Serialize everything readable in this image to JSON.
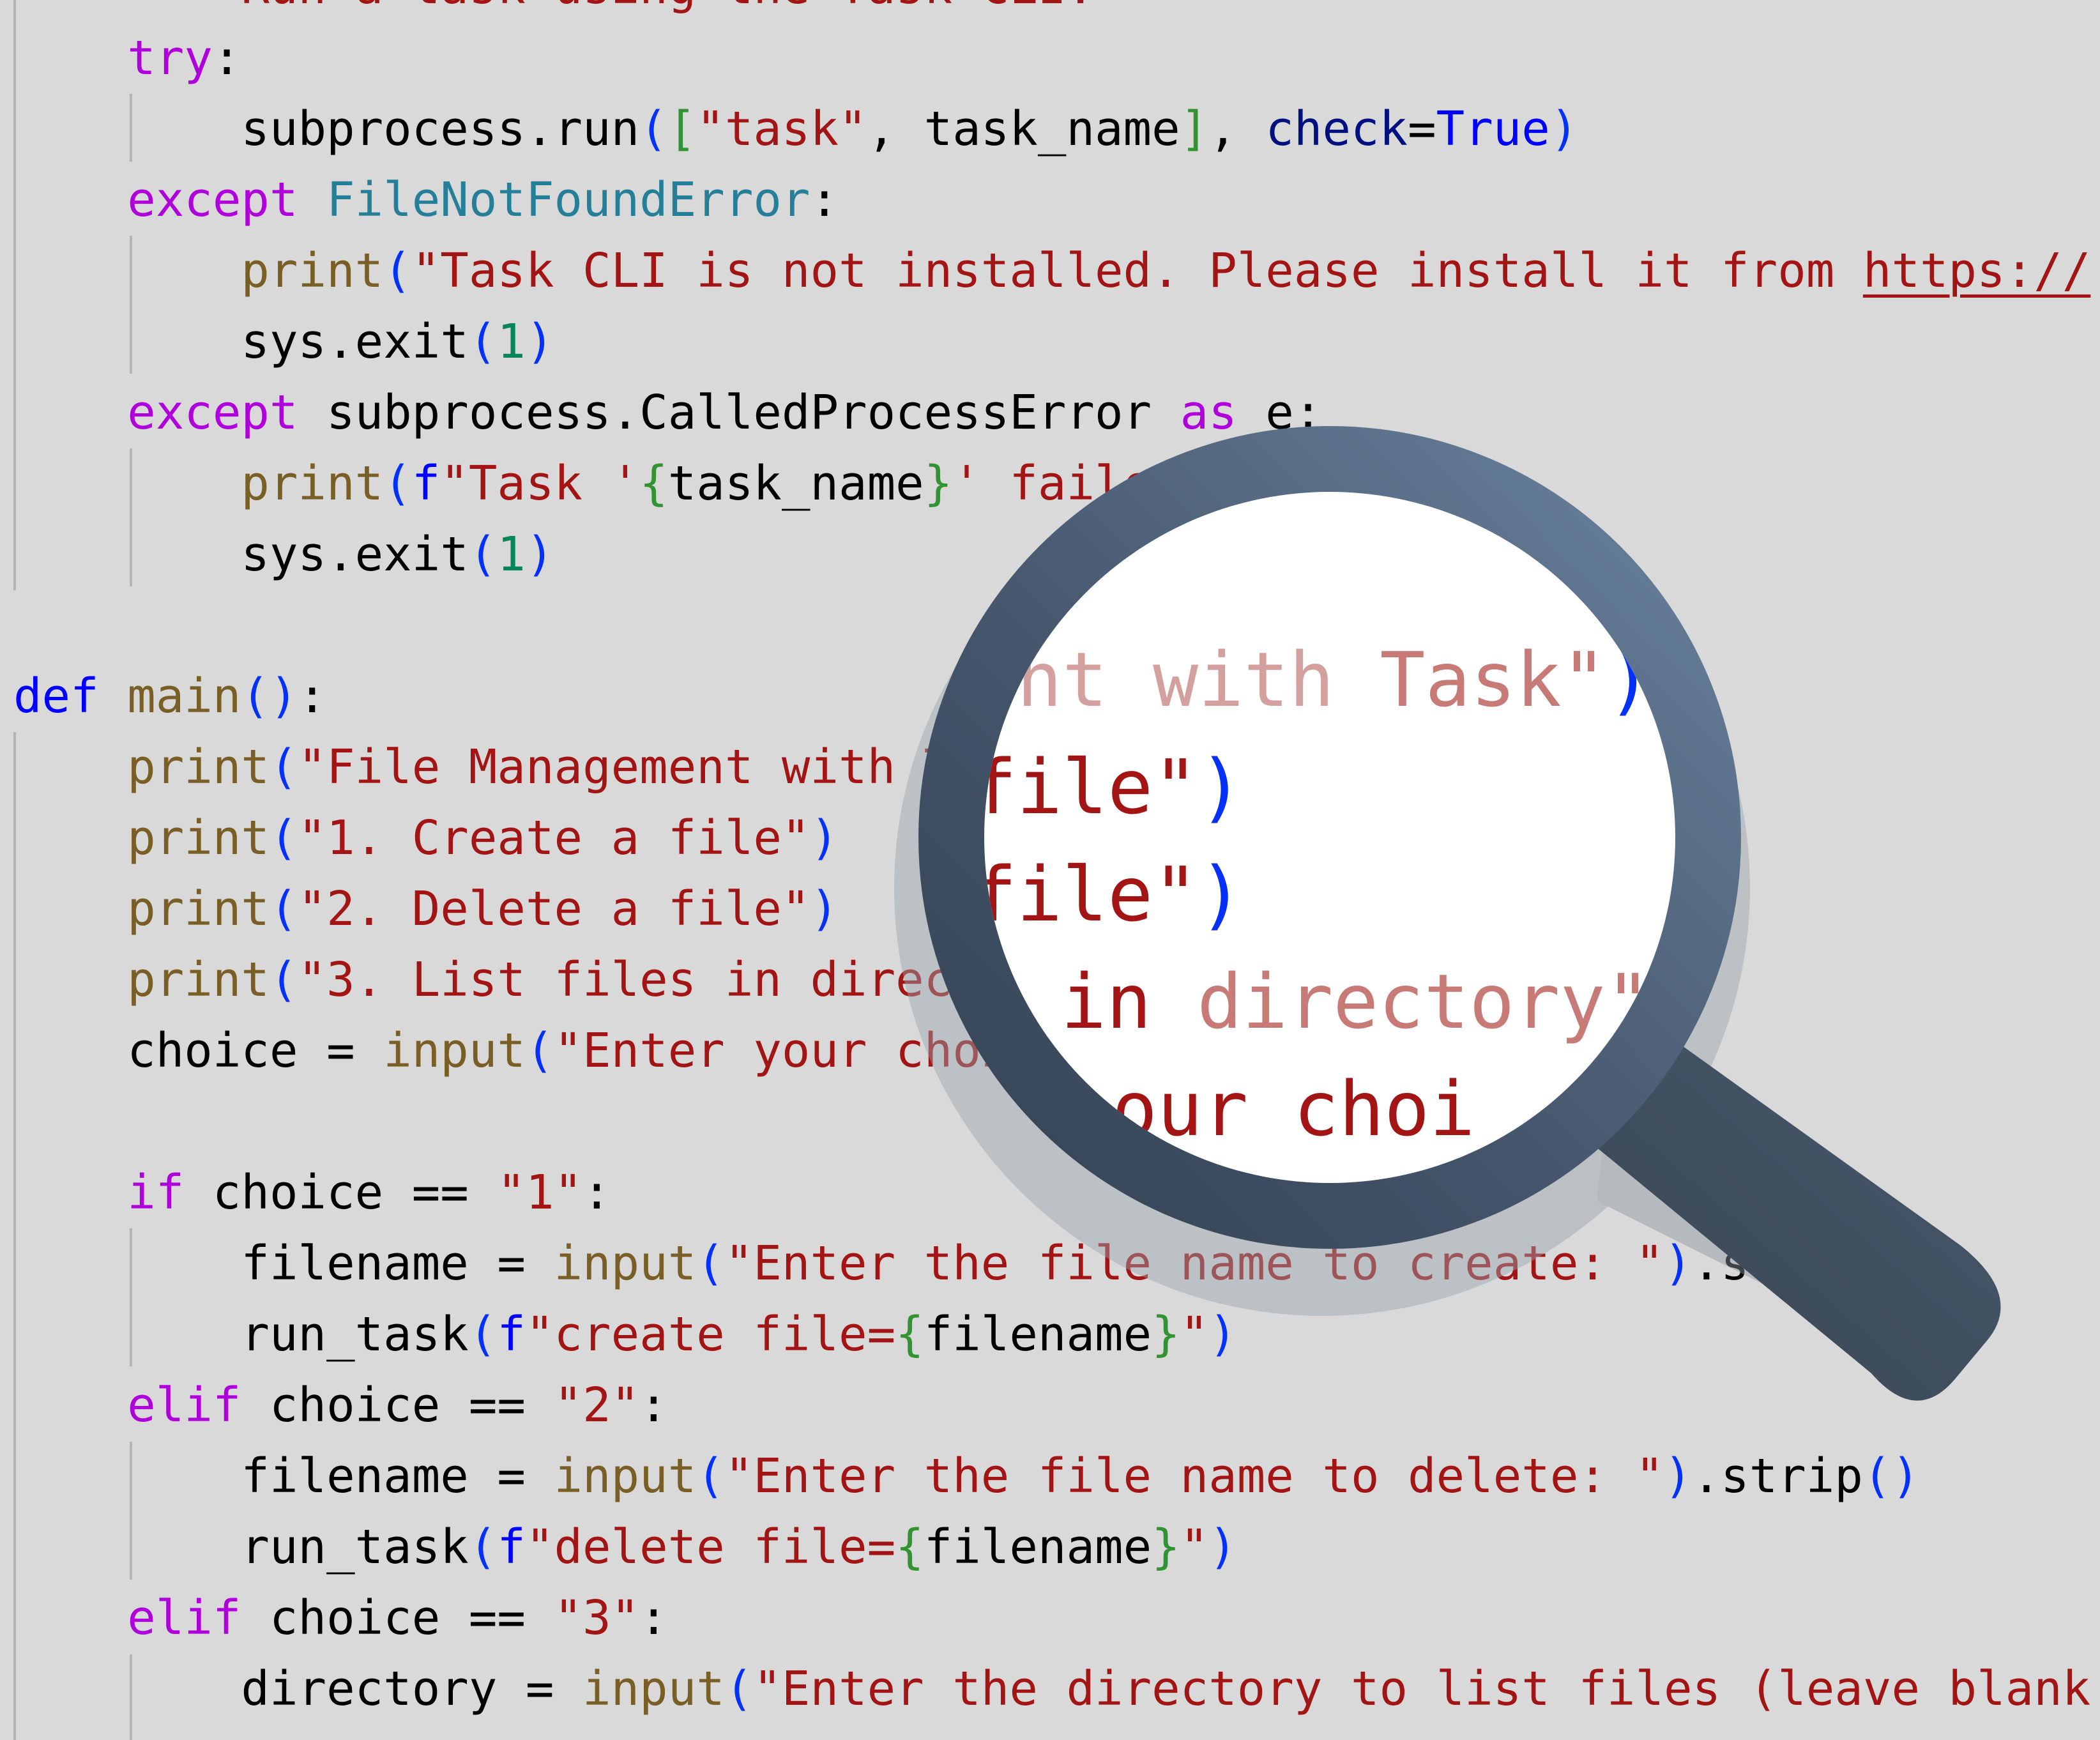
{
  "editor": {
    "language": "python",
    "colors": {
      "background": "#d9d9d9",
      "keyword_control": "#af00db",
      "keyword_def": "#0000ff",
      "function": "#795e26",
      "string": "#a31515",
      "number": "#098658",
      "paren": "#0431fa",
      "fstring_brace": "#319331",
      "class": "#267f99",
      "parameter": "#001080",
      "indent_guide": "#b4b4b4"
    },
    "lines": [
      {
        "tokens": [
          {
            "t": "        Run a task using the Task CLI.",
            "c": "str"
          }
        ]
      },
      {
        "tokens": [
          {
            "t": "    "
          },
          {
            "t": "try",
            "c": "kw"
          },
          {
            "t": ":"
          }
        ]
      },
      {
        "tokens": [
          {
            "t": "        subprocess.run"
          },
          {
            "t": "(",
            "c": "par"
          },
          {
            "t": "[",
            "c": "brk"
          },
          {
            "t": "\"task\"",
            "c": "str"
          },
          {
            "t": ", task_name"
          },
          {
            "t": "]",
            "c": "brk"
          },
          {
            "t": ", "
          },
          {
            "t": "check",
            "c": "param"
          },
          {
            "t": "="
          },
          {
            "t": "True",
            "c": "const"
          },
          {
            "t": ")",
            "c": "par"
          }
        ]
      },
      {
        "tokens": [
          {
            "t": "    "
          },
          {
            "t": "except",
            "c": "kw"
          },
          {
            "t": " "
          },
          {
            "t": "FileNotFoundError",
            "c": "cls"
          },
          {
            "t": ":"
          }
        ]
      },
      {
        "tokens": [
          {
            "t": "        "
          },
          {
            "t": "print",
            "c": "fn"
          },
          {
            "t": "(",
            "c": "par"
          },
          {
            "t": "\"Task CLI is not installed. Please install it from ",
            "c": "str"
          },
          {
            "t": "https://",
            "c": "str url"
          }
        ]
      },
      {
        "tokens": [
          {
            "t": "        sys.exit"
          },
          {
            "t": "(",
            "c": "par"
          },
          {
            "t": "1",
            "c": "num"
          },
          {
            "t": ")",
            "c": "par"
          }
        ]
      },
      {
        "tokens": [
          {
            "t": "    "
          },
          {
            "t": "except",
            "c": "kw"
          },
          {
            "t": " subprocess.CalledProcessError "
          },
          {
            "t": "as",
            "c": "kw"
          },
          {
            "t": " e:"
          }
        ]
      },
      {
        "tokens": [
          {
            "t": "        "
          },
          {
            "t": "print",
            "c": "fn"
          },
          {
            "t": "(",
            "c": "par"
          },
          {
            "t": "f",
            "c": "def"
          },
          {
            "t": "\"Task '",
            "c": "str"
          },
          {
            "t": "{",
            "c": "brk"
          },
          {
            "t": "task_name"
          },
          {
            "t": "}",
            "c": "brk"
          },
          {
            "t": "' failed",
            "c": "str"
          }
        ]
      },
      {
        "tokens": [
          {
            "t": "        sys.exit"
          },
          {
            "t": "(",
            "c": "par"
          },
          {
            "t": "1",
            "c": "num"
          },
          {
            "t": ")",
            "c": "par"
          }
        ]
      },
      {
        "tokens": []
      },
      {
        "tokens": [
          {
            "t": "def",
            "c": "def"
          },
          {
            "t": " "
          },
          {
            "t": "main",
            "c": "fn"
          },
          {
            "t": "()",
            "c": "par"
          },
          {
            "t": ":"
          }
        ]
      },
      {
        "tokens": [
          {
            "t": "    "
          },
          {
            "t": "print",
            "c": "fn"
          },
          {
            "t": "(",
            "c": "par"
          },
          {
            "t": "\"File Management with Task\"",
            "c": "str"
          },
          {
            "t": ")",
            "c": "par"
          }
        ]
      },
      {
        "tokens": [
          {
            "t": "    "
          },
          {
            "t": "print",
            "c": "fn"
          },
          {
            "t": "(",
            "c": "par"
          },
          {
            "t": "\"1. Create a file\"",
            "c": "str"
          },
          {
            "t": ")",
            "c": "par"
          }
        ]
      },
      {
        "tokens": [
          {
            "t": "    "
          },
          {
            "t": "print",
            "c": "fn"
          },
          {
            "t": "(",
            "c": "par"
          },
          {
            "t": "\"2. Delete a file\"",
            "c": "str"
          },
          {
            "t": ")",
            "c": "par"
          }
        ]
      },
      {
        "tokens": [
          {
            "t": "    "
          },
          {
            "t": "print",
            "c": "fn"
          },
          {
            "t": "(",
            "c": "par"
          },
          {
            "t": "\"3. List files in directory\"",
            "c": "str"
          },
          {
            "t": ")",
            "c": "par"
          }
        ]
      },
      {
        "tokens": [
          {
            "t": "    choice = "
          },
          {
            "t": "input",
            "c": "fn"
          },
          {
            "t": "(",
            "c": "par"
          },
          {
            "t": "\"Enter your choice",
            "c": "str"
          }
        ]
      },
      {
        "tokens": []
      },
      {
        "tokens": [
          {
            "t": "    "
          },
          {
            "t": "if",
            "c": "kw"
          },
          {
            "t": " choice == "
          },
          {
            "t": "\"1\"",
            "c": "str"
          },
          {
            "t": ":"
          }
        ]
      },
      {
        "tokens": [
          {
            "t": "        filename = "
          },
          {
            "t": "input",
            "c": "fn"
          },
          {
            "t": "(",
            "c": "par"
          },
          {
            "t": "\"Enter the file name to create: \"",
            "c": "str"
          },
          {
            "t": ")",
            "c": "par"
          },
          {
            "t": ".strip"
          },
          {
            "t": "()",
            "c": "par"
          }
        ]
      },
      {
        "tokens": [
          {
            "t": "        run_task"
          },
          {
            "t": "(",
            "c": "par"
          },
          {
            "t": "f",
            "c": "def"
          },
          {
            "t": "\"create file=",
            "c": "str"
          },
          {
            "t": "{",
            "c": "brk"
          },
          {
            "t": "filename"
          },
          {
            "t": "}",
            "c": "brk"
          },
          {
            "t": "\"",
            "c": "str"
          },
          {
            "t": ")",
            "c": "par"
          }
        ]
      },
      {
        "tokens": [
          {
            "t": "    "
          },
          {
            "t": "elif",
            "c": "kw"
          },
          {
            "t": " choice == "
          },
          {
            "t": "\"2\"",
            "c": "str"
          },
          {
            "t": ":"
          }
        ]
      },
      {
        "tokens": [
          {
            "t": "        filename = "
          },
          {
            "t": "input",
            "c": "fn"
          },
          {
            "t": "(",
            "c": "par"
          },
          {
            "t": "\"Enter the file name to delete: \"",
            "c": "str"
          },
          {
            "t": ")",
            "c": "par"
          },
          {
            "t": ".strip"
          },
          {
            "t": "()",
            "c": "par"
          }
        ]
      },
      {
        "tokens": [
          {
            "t": "        run_task"
          },
          {
            "t": "(",
            "c": "par"
          },
          {
            "t": "f",
            "c": "def"
          },
          {
            "t": "\"delete file=",
            "c": "str"
          },
          {
            "t": "{",
            "c": "brk"
          },
          {
            "t": "filename"
          },
          {
            "t": "}",
            "c": "brk"
          },
          {
            "t": "\"",
            "c": "str"
          },
          {
            "t": ")",
            "c": "par"
          }
        ]
      },
      {
        "tokens": [
          {
            "t": "    "
          },
          {
            "t": "elif",
            "c": "kw"
          },
          {
            "t": " choice == "
          },
          {
            "t": "\"3\"",
            "c": "str"
          },
          {
            "t": ":"
          }
        ]
      },
      {
        "tokens": [
          {
            "t": "        directory = "
          },
          {
            "t": "input",
            "c": "fn"
          },
          {
            "t": "(",
            "c": "par"
          },
          {
            "t": "\"Enter the directory to list files (leave blank",
            "c": "str"
          }
        ]
      }
    ]
  },
  "magnifier": {
    "icon": "magnifying-glass-icon",
    "ring_color_light": "#6a839e",
    "ring_color_dark": "#344253",
    "lens_color": "#ffffff",
    "magnified_lines": [
      {
        "tokens": [
          {
            "t": "ent with ",
            "c": "fade1"
          },
          {
            "t": "Task\"",
            "c": "fade2"
          },
          {
            "t": ")",
            "c": "par"
          }
        ]
      },
      {
        "tokens": [
          {
            "t": "file\"",
            "c": "str"
          },
          {
            "t": ")",
            "c": "par"
          }
        ]
      },
      {
        "tokens": [
          {
            "t": "file\"",
            "c": "str"
          },
          {
            "t": ")",
            "c": "par"
          }
        ]
      },
      {
        "tokens": [
          {
            "t": "in ",
            "c": "str"
          },
          {
            "t": "directory\"",
            "c": "fade2"
          }
        ]
      },
      {
        "tokens": [
          {
            "t": "our choi",
            "c": "str"
          }
        ]
      }
    ]
  }
}
